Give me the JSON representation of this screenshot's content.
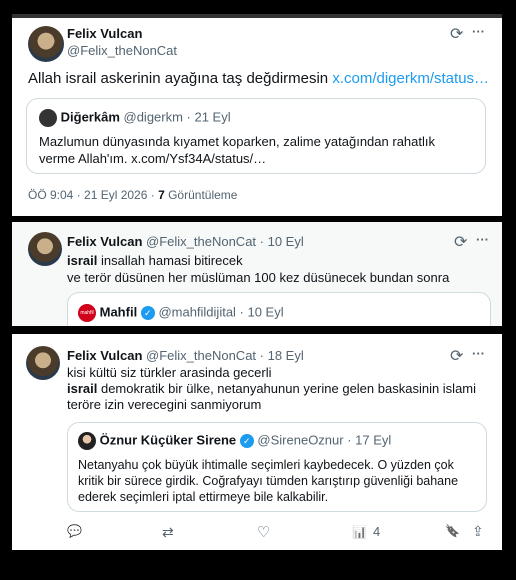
{
  "tweet1": {
    "name": "Felix Vulcan",
    "handle": "@Felix_theNonCat",
    "text": "Allah israil askerinin ayağına taş değdirmesin ",
    "link": "x.com/digerkm/status…",
    "quote": {
      "name": "Diğerkâm",
      "handle": "@digerkm · 21 Eyl",
      "text": "Mazlumun dünyasında kıyamet koparken, zalime yatağından rahatlık verme Allah'ım. x.com/Ysf34A/status/…"
    },
    "meta_time": "ÖÖ 9:04 · 21 Eyl 2026 · ",
    "views_count": "7",
    "views_label": " Görüntüleme"
  },
  "tweet2": {
    "name": "Felix Vulcan",
    "handle": "@Felix_theNonCat · 10 Eyl",
    "line1_bold": "israil",
    "line1_rest": " insallah hamasi bitirecek",
    "line2": "ve terör düsünen her müslüman 100 kez düsünecek bundan sonra",
    "quote": {
      "name": "Mahfil",
      "handle": "@mahfildijital · 10 Eyl",
      "avatar_text": "mahfil"
    }
  },
  "tweet3": {
    "name": "Felix Vulcan",
    "handle": "@Felix_theNonCat · 18 Eyl",
    "line1": "kisi kültü siz türkler arasinda gecerli",
    "line2_bold": "israil",
    "line2_rest": " demokratik bir ülke, netanyahunun yerine gelen baskasinin islami teröre izin verecegini sanmiyorum",
    "quote": {
      "name": "Öznur Küçüker Sirene",
      "handle": "@SireneOznur · 17 Eyl",
      "text": "Netanyahu çok büyük ihtimalle seçimleri kaybedecek. O yüzden çok kritik bir sürece girdik. Coğrafyayı tümden karıştırıp güvenliği bahane ederek seçimleri iptal ettirmeye bile kalkabilir."
    },
    "views": "4"
  },
  "icons": {
    "grok": "⟳",
    "more": "···",
    "reply": "💬",
    "retweet": "⇄",
    "like": "♡",
    "views": "📊",
    "bookmark": "🔖",
    "share": "⇪"
  }
}
